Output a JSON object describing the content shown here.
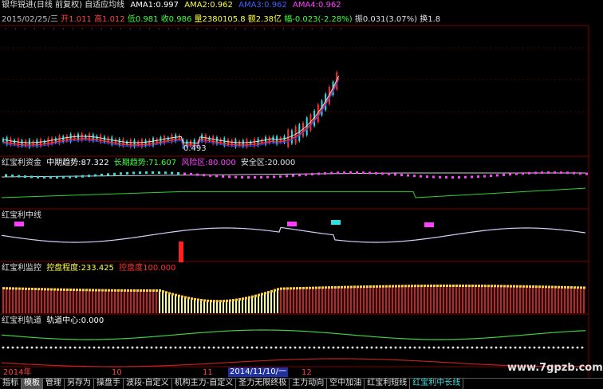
{
  "header": {
    "title": "银华锐进(日线 前复权) 自适应均线",
    "ama1_label": "AMA1:",
    "ama1_value": "0.997",
    "ama2_label": "AMA2:",
    "ama2_value": "0.962",
    "ama3_label": "AMA3:",
    "ama3_value": "0.962",
    "ama4_label": "AMA4:",
    "ama4_value": "0.962"
  },
  "quote": {
    "date": "2015/02/25/三",
    "open": "开1.011",
    "high": "高1.012",
    "low": "低0.981",
    "close": "收0.986",
    "volume": "量2380105.8",
    "amount": "额2.38亿",
    "change": "幅-0.023(-2.28%)",
    "amplitude": "振0.031(3.07%)",
    "turnover": "换1.8"
  },
  "price_panel": {
    "low_marker": "0.493"
  },
  "panel_fund": {
    "name": "红宝利资金",
    "mid_label": "中期趋势:",
    "mid_value": "87.322",
    "long_label": "长期趋势:",
    "long_value": "71.607",
    "risk_label": "风险区:",
    "risk_value": "80.000",
    "safe_label": "安全区:",
    "safe_value": "20.000"
  },
  "panel_mid": {
    "name": "红宝利中线"
  },
  "panel_monitor": {
    "name": "红宝利监控",
    "ctrl_label": "控盘程度:",
    "ctrl_value": "233.425",
    "full_label": "控盘度",
    "full_value": "100.000"
  },
  "panel_track": {
    "name": "红宝利轨道",
    "center_label": "轨道中心:",
    "center_value": "0.000"
  },
  "axis": {
    "year": "2014年",
    "m10": "10",
    "m11": "11",
    "cursor_date": "2014/11/10/一",
    "m12": "12"
  },
  "tabs": [
    "指标",
    "模板",
    "管理",
    "另存为",
    "操盘手",
    "波段-自定义",
    "机构主力-自定义",
    "圣力无限终极",
    "主力动向",
    "空中加油",
    "红宝利短线",
    "红宝利中长线"
  ],
  "watermark": "www.7gpzb.com",
  "colors": {
    "up": "#ff3030",
    "down": "#30e0e0",
    "ama": "#ffffff",
    "bg": "#000000"
  }
}
